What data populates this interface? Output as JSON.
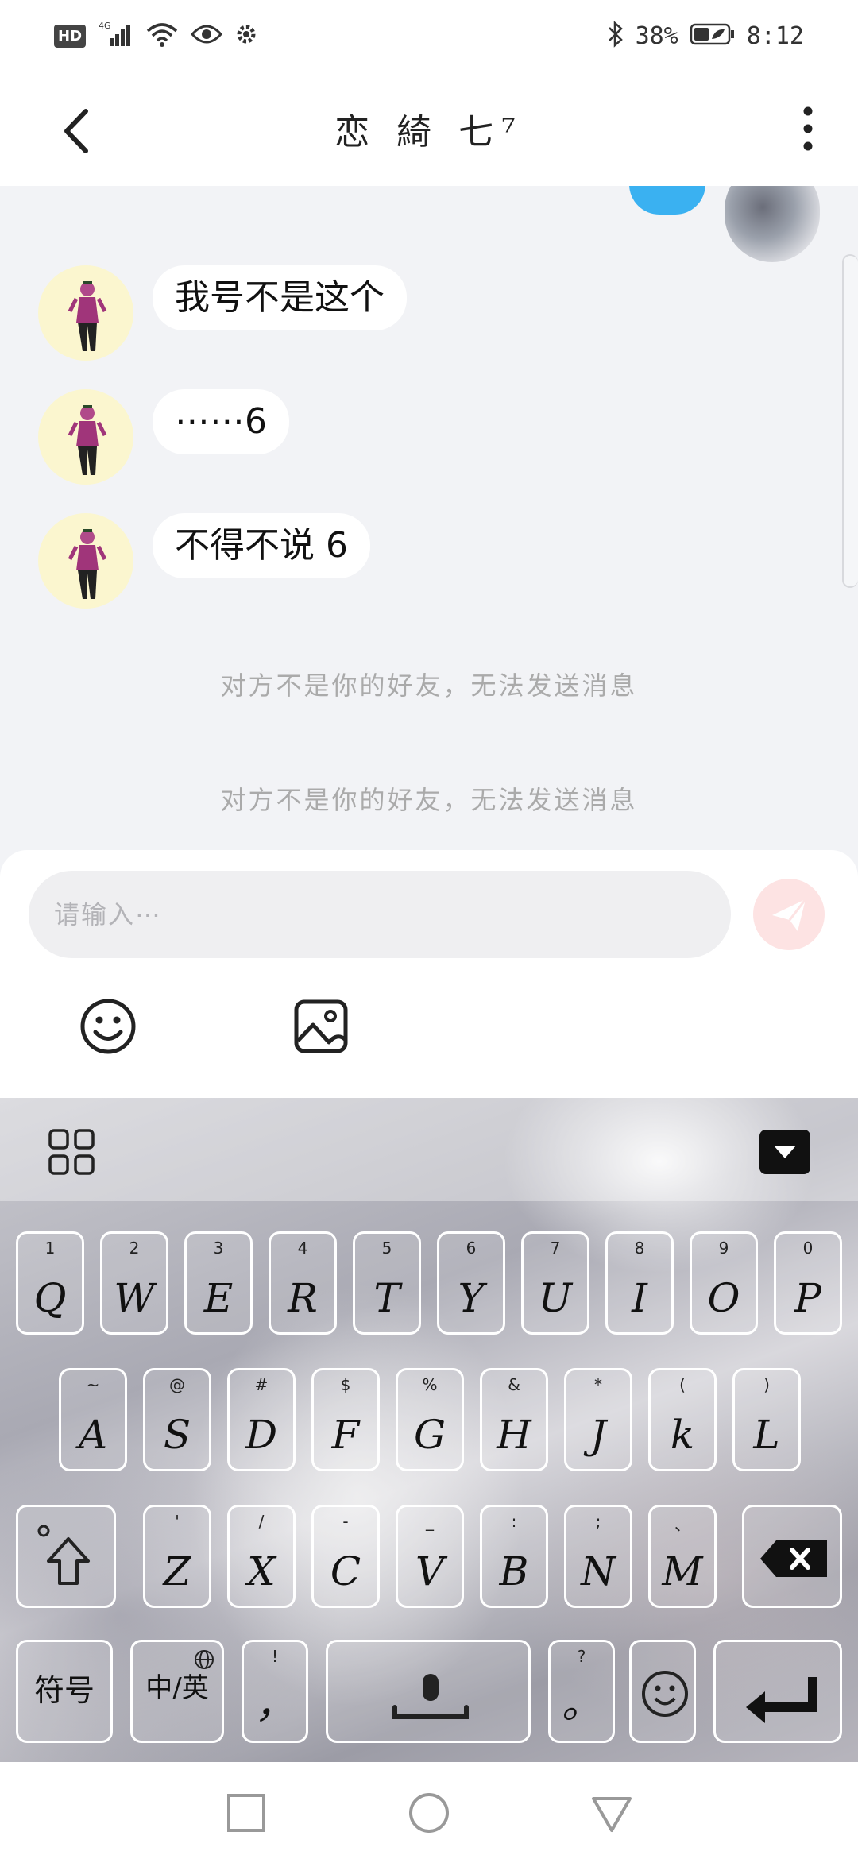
{
  "status_bar": {
    "hd": "HD",
    "network": "4G",
    "battery": "38%",
    "time": "8:12"
  },
  "header": {
    "title": "恋 綺 七⁷"
  },
  "chat": {
    "top_bubble_text": "...",
    "messages": [
      {
        "text": "我号不是这个"
      },
      {
        "text": "⋯⋯6"
      },
      {
        "text": "不得不说  6"
      }
    ],
    "notices": [
      "对方不是你的好友，无法发送消息",
      "对方不是你的好友，无法发送消息"
    ]
  },
  "composer": {
    "placeholder": "请输入⋯"
  },
  "keyboard": {
    "row1": [
      {
        "main": "Q",
        "sub": "1"
      },
      {
        "main": "W",
        "sub": "2"
      },
      {
        "main": "E",
        "sub": "3"
      },
      {
        "main": "R",
        "sub": "4"
      },
      {
        "main": "T",
        "sub": "5"
      },
      {
        "main": "Y",
        "sub": "6"
      },
      {
        "main": "U",
        "sub": "7"
      },
      {
        "main": "I",
        "sub": "8"
      },
      {
        "main": "O",
        "sub": "9"
      },
      {
        "main": "P",
        "sub": "0"
      }
    ],
    "row2": [
      {
        "main": "A",
        "sub": "~"
      },
      {
        "main": "S",
        "sub": "@"
      },
      {
        "main": "D",
        "sub": "#"
      },
      {
        "main": "F",
        "sub": "$"
      },
      {
        "main": "G",
        "sub": "%"
      },
      {
        "main": "H",
        "sub": "&"
      },
      {
        "main": "J",
        "sub": "*"
      },
      {
        "main": "k",
        "sub": "("
      },
      {
        "main": "L",
        "sub": ")"
      }
    ],
    "row3": [
      {
        "main": "Z",
        "sub": "'"
      },
      {
        "main": "X",
        "sub": "/"
      },
      {
        "main": "C",
        "sub": "-"
      },
      {
        "main": "V",
        "sub": "_"
      },
      {
        "main": "B",
        "sub": ":"
      },
      {
        "main": "N",
        "sub": ";"
      },
      {
        "main": "M",
        "sub": "、"
      }
    ],
    "symbol_key": "符号",
    "lang_key": "中/英",
    "comma_key": {
      "main": "，",
      "sub": "!"
    },
    "period_key": {
      "main": "。",
      "sub": "?"
    }
  }
}
